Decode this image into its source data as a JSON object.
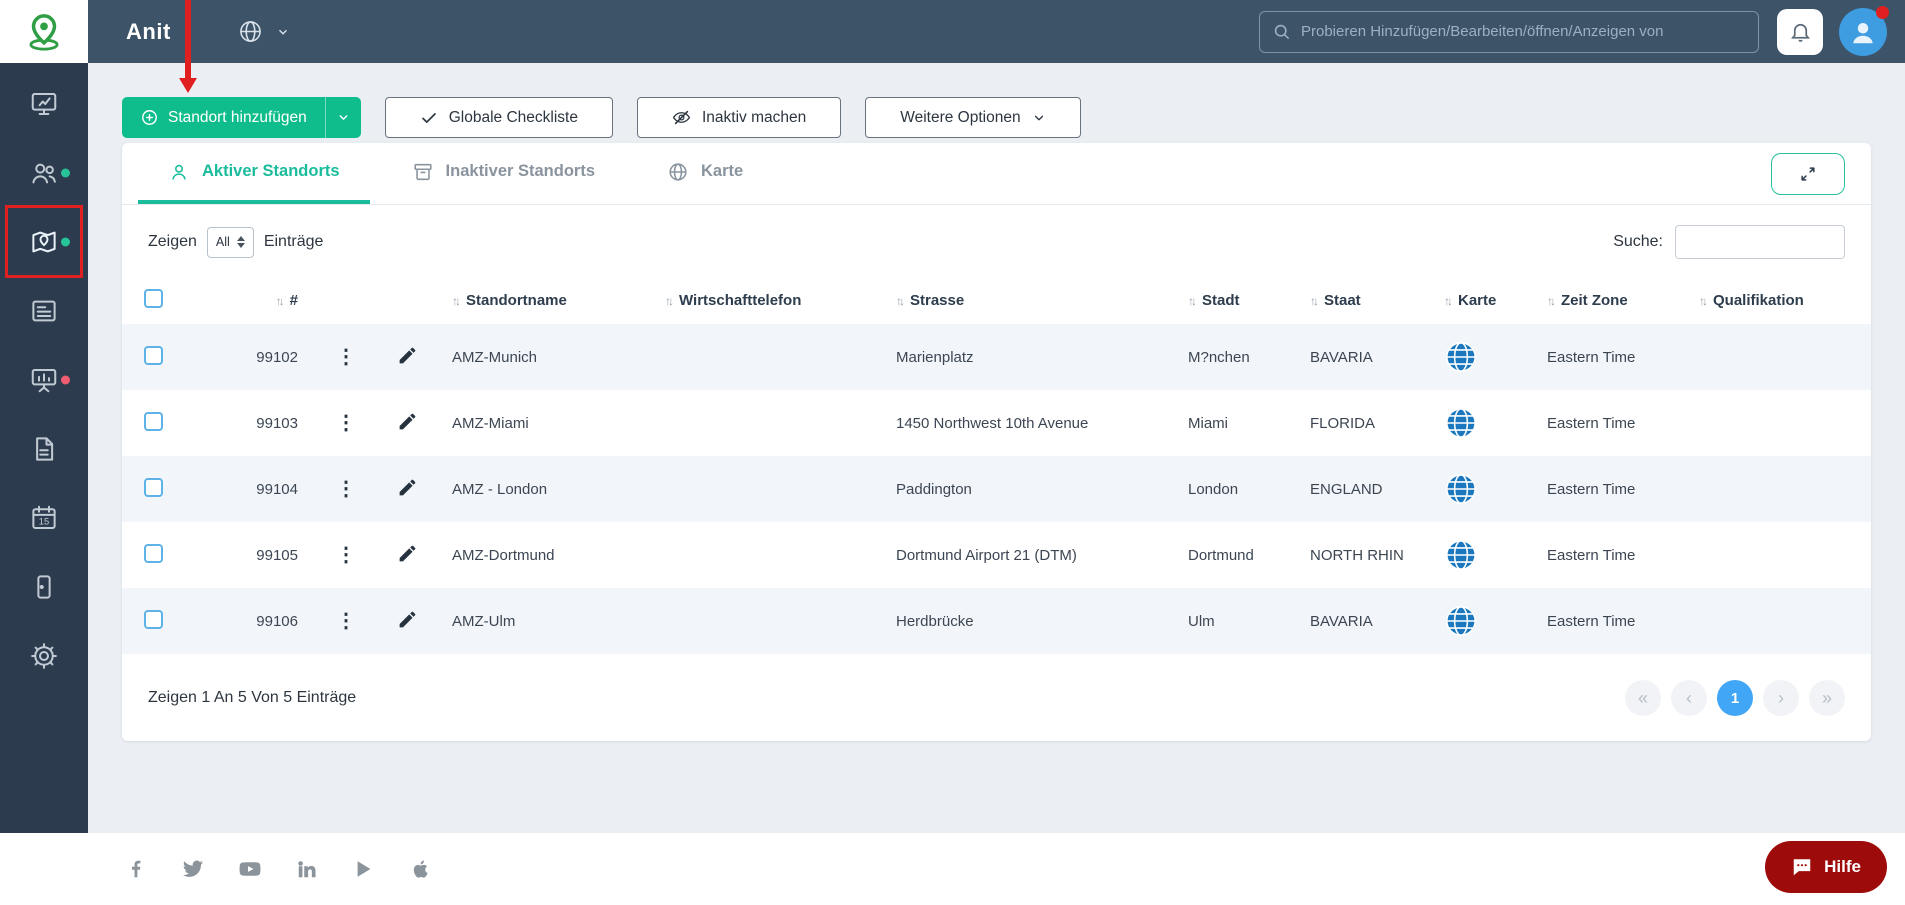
{
  "colors": {
    "topbar_bg": "#3d5368",
    "sidebar_bg": "#2c3b4e",
    "accent_green": "#0fbc8c",
    "tab_active_teal": "#1abc9c",
    "map_globe_blue": "#1b78be",
    "pagination_active_blue": "#41a6f5",
    "help_button_red": "#9e0b0b",
    "annotation_red": "#e02020"
  },
  "topbar": {
    "brand": "Anit",
    "search_placeholder": "Probieren Hinzufügen/Bearbeiten/öffnen/Anzeigen von"
  },
  "sidebar": {
    "calendar_day": "15",
    "icons": [
      "dashboard-icon",
      "users-icon",
      "locations-map-icon",
      "news-list-icon",
      "performance-chart-icon",
      "document-icon",
      "calendar-icon",
      "device-icon",
      "settings-gear-icon"
    ]
  },
  "toolbar": {
    "add_location_label": "Standort hinzufügen",
    "global_checklist_label": "Globale Checkliste",
    "make_inactive_label": "Inaktiv machen",
    "more_options_label": "Weitere Optionen"
  },
  "tabs": {
    "active_label": "Aktiver Standorts",
    "inactive_label": "Inaktiver Standorts",
    "map_label": "Karte"
  },
  "controls": {
    "show": "Zeigen",
    "page_size": "All",
    "entries": "Einträge",
    "search": "Suche:",
    "search_value": ""
  },
  "table": {
    "headers": {
      "id": "#",
      "name": "Standortname",
      "phone": "Wirtschafttelefon",
      "street": "Strasse",
      "city": "Stadt",
      "state": "Staat",
      "map": "Karte",
      "timezone": "Zeit Zone",
      "qualification": "Qualifikation"
    },
    "rows": [
      {
        "id": "99102",
        "name": "AMZ-Munich",
        "phone": "",
        "street": "Marienplatz",
        "city": "M?nchen",
        "state": "BAVARIA",
        "timezone": "Eastern Time",
        "qualification": ""
      },
      {
        "id": "99103",
        "name": "AMZ-Miami",
        "phone": "",
        "street": "1450 Northwest 10th Avenue",
        "city": "Miami",
        "state": "FLORIDA",
        "timezone": "Eastern Time",
        "qualification": ""
      },
      {
        "id": "99104",
        "name": "AMZ - London",
        "phone": "",
        "street": "Paddington",
        "city": "London",
        "state": "ENGLAND",
        "timezone": "Eastern Time",
        "qualification": ""
      },
      {
        "id": "99105",
        "name": "AMZ-Dortmund",
        "phone": "",
        "street": "Dortmund Airport 21 (DTM)",
        "city": "Dortmund",
        "state": "NORTH RHIN",
        "timezone": "Eastern Time",
        "qualification": ""
      },
      {
        "id": "99106",
        "name": "AMZ-Ulm",
        "phone": "",
        "street": "Herdbrücke",
        "city": "Ulm",
        "state": "BAVARIA",
        "timezone": "Eastern Time",
        "qualification": ""
      }
    ]
  },
  "table_footer": {
    "info": "Zeigen 1 An 5 Von 5 Einträge",
    "first": "«",
    "prev": "‹",
    "page": "1",
    "next": "›",
    "last": "»"
  },
  "footer": {
    "help": "Hilfe",
    "social_icons": [
      "facebook-icon",
      "twitter-icon",
      "youtube-icon",
      "linkedin-icon",
      "google-play-icon",
      "apple-icon"
    ]
  }
}
